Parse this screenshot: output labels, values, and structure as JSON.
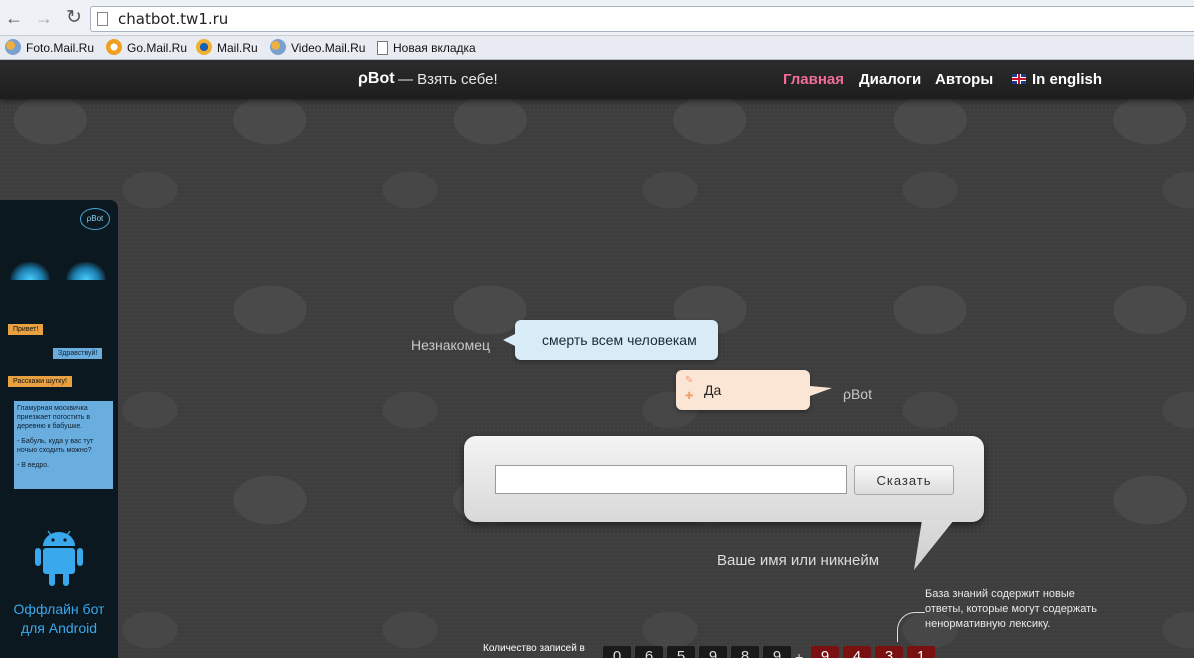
{
  "browser": {
    "url": "chatbot.tw1.ru",
    "bookmarks": [
      {
        "label": "Foto.Mail.Ru",
        "icon": "people-icon"
      },
      {
        "label": "Go.Mail.Ru",
        "icon": "search-icon"
      },
      {
        "label": "Mail.Ru",
        "icon": "at-icon"
      },
      {
        "label": "Video.Mail.Ru",
        "icon": "people-icon"
      },
      {
        "label": "Новая вкладка",
        "icon": "page-icon"
      }
    ]
  },
  "header": {
    "logo": "ρBot",
    "tagline": "— Взять себе!",
    "menu": [
      {
        "label": "Главная",
        "active": true
      },
      {
        "label": "Диалоги",
        "active": false
      },
      {
        "label": "Авторы",
        "active": false
      },
      {
        "label": "In english",
        "active": false
      }
    ]
  },
  "ad": {
    "logo": "ρBot",
    "bubble1": "Привет!",
    "bubble2": "Здравствуй!",
    "bubble3": "Расскажи шутку!",
    "joke": [
      "Гламурная москвичка приезжает погостить в деревню к бабушке.",
      "- Бабуль, куда у вас тут ночью сходить можно?",
      "- В ведро."
    ],
    "text_line1": "Оффлайн бот",
    "text_line2": "для Android"
  },
  "chat": {
    "user_name": "Незнакомец",
    "user_message": "смерть всем человекам",
    "bot_name": "ρBot",
    "bot_message": "Да"
  },
  "form": {
    "input_value": "",
    "button_label": "Сказать",
    "nickname_hint": "Ваше имя или никнейм"
  },
  "info": {
    "note": "База знаний содержит новые ответы, которые могут содержать ненормативную лексику.",
    "counter_label": "Количество записей в",
    "digits": [
      "0",
      "6",
      "5",
      "9",
      "8",
      "9"
    ],
    "new_digits": [
      "9",
      "4",
      "3",
      "1"
    ]
  },
  "colors": {
    "accent": "#f26b9a",
    "android": "#3aa8ec"
  }
}
